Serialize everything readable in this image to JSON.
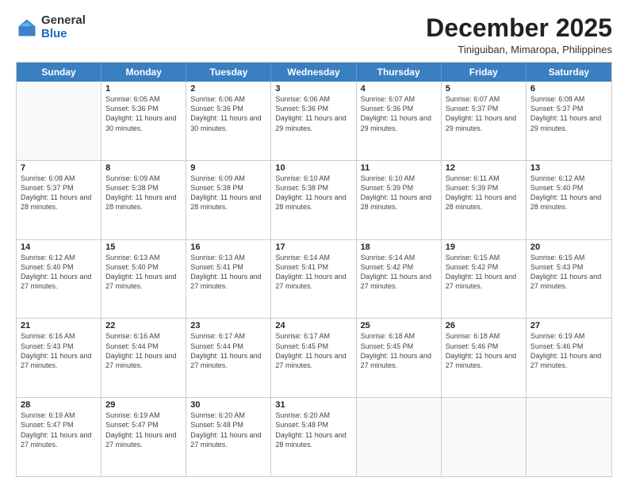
{
  "logo": {
    "general": "General",
    "blue": "Blue"
  },
  "title": "December 2025",
  "subtitle": "Tiniguiban, Mimaropa, Philippines",
  "header_days": [
    "Sunday",
    "Monday",
    "Tuesday",
    "Wednesday",
    "Thursday",
    "Friday",
    "Saturday"
  ],
  "weeks": [
    [
      {
        "day": "",
        "empty": true
      },
      {
        "day": "1",
        "sunrise": "Sunrise: 6:05 AM",
        "sunset": "Sunset: 5:36 PM",
        "daylight": "Daylight: 11 hours and 30 minutes."
      },
      {
        "day": "2",
        "sunrise": "Sunrise: 6:06 AM",
        "sunset": "Sunset: 5:36 PM",
        "daylight": "Daylight: 11 hours and 30 minutes."
      },
      {
        "day": "3",
        "sunrise": "Sunrise: 6:06 AM",
        "sunset": "Sunset: 5:36 PM",
        "daylight": "Daylight: 11 hours and 29 minutes."
      },
      {
        "day": "4",
        "sunrise": "Sunrise: 6:07 AM",
        "sunset": "Sunset: 5:36 PM",
        "daylight": "Daylight: 11 hours and 29 minutes."
      },
      {
        "day": "5",
        "sunrise": "Sunrise: 6:07 AM",
        "sunset": "Sunset: 5:37 PM",
        "daylight": "Daylight: 11 hours and 29 minutes."
      },
      {
        "day": "6",
        "sunrise": "Sunrise: 6:08 AM",
        "sunset": "Sunset: 5:37 PM",
        "daylight": "Daylight: 11 hours and 29 minutes."
      }
    ],
    [
      {
        "day": "7",
        "sunrise": "Sunrise: 6:08 AM",
        "sunset": "Sunset: 5:37 PM",
        "daylight": "Daylight: 11 hours and 28 minutes."
      },
      {
        "day": "8",
        "sunrise": "Sunrise: 6:09 AM",
        "sunset": "Sunset: 5:38 PM",
        "daylight": "Daylight: 11 hours and 28 minutes."
      },
      {
        "day": "9",
        "sunrise": "Sunrise: 6:09 AM",
        "sunset": "Sunset: 5:38 PM",
        "daylight": "Daylight: 11 hours and 28 minutes."
      },
      {
        "day": "10",
        "sunrise": "Sunrise: 6:10 AM",
        "sunset": "Sunset: 5:38 PM",
        "daylight": "Daylight: 11 hours and 28 minutes."
      },
      {
        "day": "11",
        "sunrise": "Sunrise: 6:10 AM",
        "sunset": "Sunset: 5:39 PM",
        "daylight": "Daylight: 11 hours and 28 minutes."
      },
      {
        "day": "12",
        "sunrise": "Sunrise: 6:11 AM",
        "sunset": "Sunset: 5:39 PM",
        "daylight": "Daylight: 11 hours and 28 minutes."
      },
      {
        "day": "13",
        "sunrise": "Sunrise: 6:12 AM",
        "sunset": "Sunset: 5:40 PM",
        "daylight": "Daylight: 11 hours and 28 minutes."
      }
    ],
    [
      {
        "day": "14",
        "sunrise": "Sunrise: 6:12 AM",
        "sunset": "Sunset: 5:40 PM",
        "daylight": "Daylight: 11 hours and 27 minutes."
      },
      {
        "day": "15",
        "sunrise": "Sunrise: 6:13 AM",
        "sunset": "Sunset: 5:40 PM",
        "daylight": "Daylight: 11 hours and 27 minutes."
      },
      {
        "day": "16",
        "sunrise": "Sunrise: 6:13 AM",
        "sunset": "Sunset: 5:41 PM",
        "daylight": "Daylight: 11 hours and 27 minutes."
      },
      {
        "day": "17",
        "sunrise": "Sunrise: 6:14 AM",
        "sunset": "Sunset: 5:41 PM",
        "daylight": "Daylight: 11 hours and 27 minutes."
      },
      {
        "day": "18",
        "sunrise": "Sunrise: 6:14 AM",
        "sunset": "Sunset: 5:42 PM",
        "daylight": "Daylight: 11 hours and 27 minutes."
      },
      {
        "day": "19",
        "sunrise": "Sunrise: 6:15 AM",
        "sunset": "Sunset: 5:42 PM",
        "daylight": "Daylight: 11 hours and 27 minutes."
      },
      {
        "day": "20",
        "sunrise": "Sunrise: 6:15 AM",
        "sunset": "Sunset: 5:43 PM",
        "daylight": "Daylight: 11 hours and 27 minutes."
      }
    ],
    [
      {
        "day": "21",
        "sunrise": "Sunrise: 6:16 AM",
        "sunset": "Sunset: 5:43 PM",
        "daylight": "Daylight: 11 hours and 27 minutes."
      },
      {
        "day": "22",
        "sunrise": "Sunrise: 6:16 AM",
        "sunset": "Sunset: 5:44 PM",
        "daylight": "Daylight: 11 hours and 27 minutes."
      },
      {
        "day": "23",
        "sunrise": "Sunrise: 6:17 AM",
        "sunset": "Sunset: 5:44 PM",
        "daylight": "Daylight: 11 hours and 27 minutes."
      },
      {
        "day": "24",
        "sunrise": "Sunrise: 6:17 AM",
        "sunset": "Sunset: 5:45 PM",
        "daylight": "Daylight: 11 hours and 27 minutes."
      },
      {
        "day": "25",
        "sunrise": "Sunrise: 6:18 AM",
        "sunset": "Sunset: 5:45 PM",
        "daylight": "Daylight: 11 hours and 27 minutes."
      },
      {
        "day": "26",
        "sunrise": "Sunrise: 6:18 AM",
        "sunset": "Sunset: 5:46 PM",
        "daylight": "Daylight: 11 hours and 27 minutes."
      },
      {
        "day": "27",
        "sunrise": "Sunrise: 6:19 AM",
        "sunset": "Sunset: 5:46 PM",
        "daylight": "Daylight: 11 hours and 27 minutes."
      }
    ],
    [
      {
        "day": "28",
        "sunrise": "Sunrise: 6:19 AM",
        "sunset": "Sunset: 5:47 PM",
        "daylight": "Daylight: 11 hours and 27 minutes."
      },
      {
        "day": "29",
        "sunrise": "Sunrise: 6:19 AM",
        "sunset": "Sunset: 5:47 PM",
        "daylight": "Daylight: 11 hours and 27 minutes."
      },
      {
        "day": "30",
        "sunrise": "Sunrise: 6:20 AM",
        "sunset": "Sunset: 5:48 PM",
        "daylight": "Daylight: 11 hours and 27 minutes."
      },
      {
        "day": "31",
        "sunrise": "Sunrise: 6:20 AM",
        "sunset": "Sunset: 5:48 PM",
        "daylight": "Daylight: 11 hours and 28 minutes."
      },
      {
        "day": "",
        "empty": true
      },
      {
        "day": "",
        "empty": true
      },
      {
        "day": "",
        "empty": true
      }
    ]
  ]
}
